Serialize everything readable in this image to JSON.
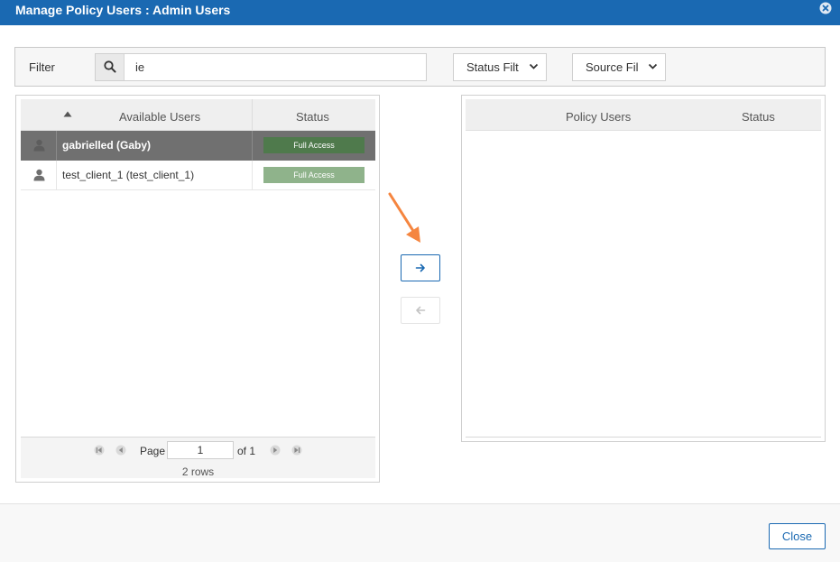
{
  "dialog": {
    "title": "Manage Policy Users : Admin Users"
  },
  "filter": {
    "label": "Filter",
    "search_value": "ie",
    "status_filter": "Status Filter",
    "source_filter": "Source Filter"
  },
  "available": {
    "col_name": "Available Users",
    "col_status": "Status",
    "sort": "ascending",
    "rows": [
      {
        "name": "gabrielled (Gaby)",
        "status": "Full Access",
        "selected": true
      },
      {
        "name": "test_client_1 (test_client_1)",
        "status": "Full Access",
        "selected": false
      }
    ],
    "pager": {
      "page_label": "Page",
      "page_value": "1",
      "of_label": "of 1",
      "rows_label": "2 rows"
    }
  },
  "policy": {
    "col_name": "Policy Users",
    "col_status": "Status"
  },
  "footer": {
    "close_label": "Close"
  },
  "colors": {
    "titlebar": "#1a69b2",
    "selected_row": "#707070",
    "badge_selected": "#4f7a4c",
    "badge": "#8fb38b",
    "accent_arrow": "#f5853f"
  }
}
